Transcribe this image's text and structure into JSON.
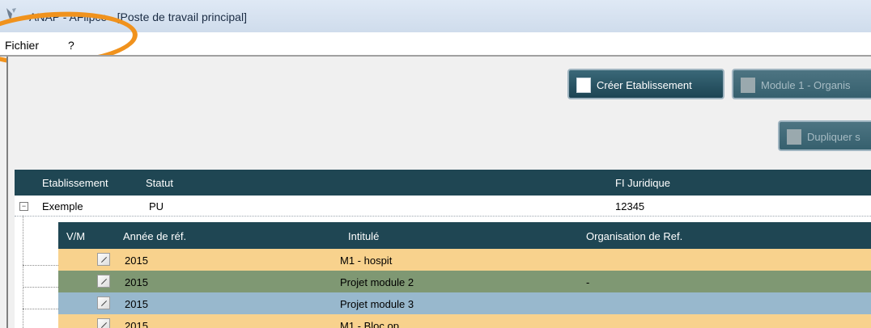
{
  "window": {
    "title": "ANAP - AFlipce - [Poste de travail principal]"
  },
  "menu": {
    "items": [
      "Fichier",
      "?"
    ]
  },
  "toolbar": {
    "create_establishment": "Créer Etablissement",
    "module1": "Module 1 - Organis",
    "duplicate": "Dupliquer s"
  },
  "grid": {
    "columns": [
      "Etablissement",
      "Statut",
      "FI Juridique"
    ],
    "rows": [
      {
        "etablissement": "Exemple",
        "statut": "PU",
        "fi_juridique": "12345"
      }
    ],
    "subgrid": {
      "columns": [
        "V/M",
        "Année de réf.",
        "Intitulé",
        "Organisation de Ref."
      ],
      "rows": [
        {
          "annee": "2015",
          "intitule": "M1 - hospit",
          "organisation": "",
          "color": "#f8d28d"
        },
        {
          "annee": "2015",
          "intitule": "Projet module 2",
          "organisation": "-",
          "color": "#7f9873"
        },
        {
          "annee": "2015",
          "intitule": "Projet module 3",
          "organisation": "",
          "color": "#98b8cd"
        },
        {
          "annee": "2015",
          "intitule": "M1 - Bloc op",
          "organisation": "",
          "color": "#f8d28d"
        }
      ]
    }
  },
  "colors": {
    "highlight": "#f0921d",
    "header_bg": "#1f4653",
    "button_bg": "#2b5666"
  }
}
